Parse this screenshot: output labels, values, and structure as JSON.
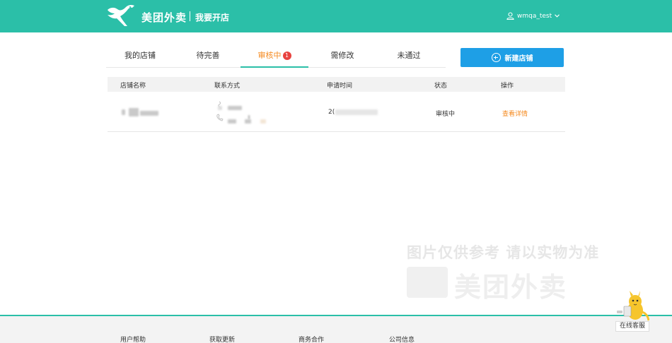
{
  "header": {
    "brand": "美团外卖",
    "subtitle": "我要开店",
    "username": "wmqa_test",
    "icons": {
      "user": "user-icon",
      "dropdown": "chevron-down-icon",
      "logo": "kangaroo-logo-icon"
    }
  },
  "tabs": [
    {
      "label": "我的店铺",
      "active": false
    },
    {
      "label": "待完善",
      "active": false
    },
    {
      "label": "审核中",
      "active": true,
      "badge": "1"
    },
    {
      "label": "需修改",
      "active": false
    },
    {
      "label": "未通过",
      "active": false
    }
  ],
  "new_store_button": {
    "label": "新建店铺",
    "icon": "plus-circle-icon"
  },
  "table": {
    "columns": [
      "店铺名称",
      "联系方式",
      "申请时间",
      "状态",
      "操作"
    ],
    "rows": [
      {
        "store_name": "",
        "contact": "",
        "apply_time": "2(",
        "status": "审核中",
        "action": "查看详情"
      }
    ]
  },
  "watermark": {
    "text": "图片仅供参考 请以实物为准",
    "brand": "美团外卖"
  },
  "footer": {
    "links": [
      "用户帮助",
      "获取更新",
      "商务合作",
      "公司信息"
    ]
  },
  "customer_service": {
    "label": "在线客服",
    "icon": "kangaroo-mascot-icon"
  },
  "colors": {
    "primary": "#2bbfa8",
    "accent": "#f5891e",
    "button": "#1e9fe6",
    "badge": "#e8433f"
  }
}
